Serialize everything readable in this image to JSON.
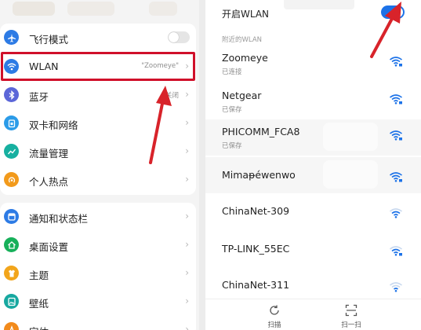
{
  "left_panel": {
    "items": [
      {
        "label": "飞行模式",
        "icon": "airplane-icon",
        "color": "#2d7be5",
        "control": "toggle-off"
      },
      {
        "label": "WLAN",
        "icon": "wifi-icon",
        "color": "#2d7be5",
        "value": "\"Zoomeye\""
      },
      {
        "label": "蓝牙",
        "icon": "bluetooth-icon",
        "color": "#5b66d8",
        "value": "关闭"
      },
      {
        "label": "双卡和网络",
        "icon": "dual-sim-icon",
        "color": "#2b9be8"
      },
      {
        "label": "流量管理",
        "icon": "chart-icon",
        "color": "#17b0a0"
      },
      {
        "label": "个人热点",
        "icon": "hotspot-icon",
        "color": "#f29a1b"
      },
      {
        "label": "通知和状态栏",
        "icon": "notification-icon",
        "color": "#2d7be5"
      },
      {
        "label": "桌面设置",
        "icon": "home-icon",
        "color": "#17b05a"
      },
      {
        "label": "主题",
        "icon": "theme-icon",
        "color": "#f2a51b"
      },
      {
        "label": "壁纸",
        "icon": "wallpaper-icon",
        "color": "#17a8a0"
      },
      {
        "label": "字体",
        "icon": "font-icon",
        "color": "#f28a1b"
      }
    ],
    "highlight_color": "#d0102a"
  },
  "right_panel": {
    "wlan_toggle_label": "开启WLAN",
    "section_label": "附近的WLAN",
    "networks": [
      {
        "name": "Zoomeye",
        "status": "已连接",
        "signal": "strong-locked"
      },
      {
        "name": "Netgear",
        "status": "已保存",
        "signal": "strong-locked"
      },
      {
        "name": "PHICOMM_FCA8",
        "status": "已保存",
        "signal": "strong-locked"
      },
      {
        "name": "Mimaᵽéwenwo",
        "status": "",
        "signal": "strong-locked"
      },
      {
        "name": "ChinaNet-309",
        "status": "",
        "signal": "medium"
      },
      {
        "name": "TP-LINK_55EC",
        "status": "",
        "signal": "medium-locked"
      },
      {
        "name": "ChinaNet-311",
        "status": "",
        "signal": "weak"
      }
    ],
    "bottom_bar": [
      {
        "label": "扫描",
        "icon": "refresh-icon"
      },
      {
        "label": "扫一扫",
        "icon": "scan-icon"
      }
    ],
    "accent_color": "#1c72e8"
  },
  "annotation_color": "#d8232a"
}
